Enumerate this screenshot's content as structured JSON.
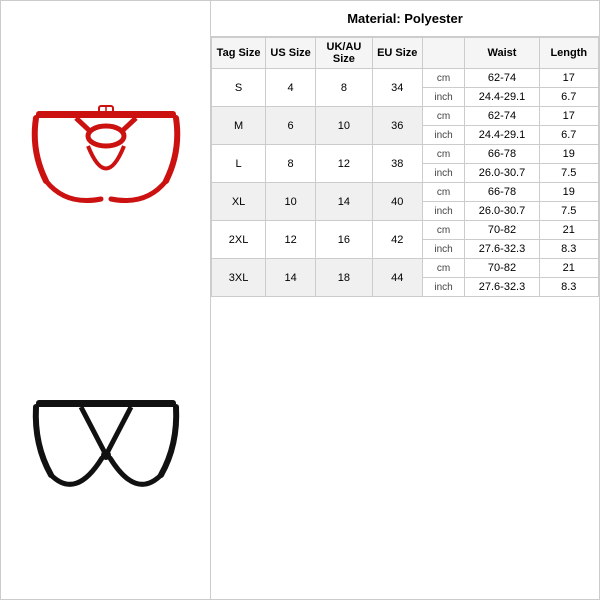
{
  "header": {
    "material_label": "Material: Polyester"
  },
  "columns": {
    "tag_size": "Tag Size",
    "us_size": "US Size",
    "ukau_size": "UK/AU Size",
    "eu_size": "EU Size",
    "waist": "Waist",
    "length": "Length"
  },
  "rows": [
    {
      "tag": "S",
      "us": "4",
      "ukau": "8",
      "eu": "34",
      "cm_waist": "62-74",
      "cm_length": "17",
      "in_waist": "24.4-29.1",
      "in_length": "6.7"
    },
    {
      "tag": "M",
      "us": "6",
      "ukau": "10",
      "eu": "36",
      "cm_waist": "62-74",
      "cm_length": "17",
      "in_waist": "24.4-29.1",
      "in_length": "6.7"
    },
    {
      "tag": "L",
      "us": "8",
      "ukau": "12",
      "eu": "38",
      "cm_waist": "66-78",
      "cm_length": "19",
      "in_waist": "26.0-30.7",
      "in_length": "7.5"
    },
    {
      "tag": "XL",
      "us": "10",
      "ukau": "14",
      "eu": "40",
      "cm_waist": "66-78",
      "cm_length": "19",
      "in_waist": "26.0-30.7",
      "in_length": "7.5"
    },
    {
      "tag": "2XL",
      "us": "12",
      "ukau": "16",
      "eu": "42",
      "cm_waist": "70-82",
      "cm_length": "21",
      "in_waist": "27.6-32.3",
      "in_length": "8.3"
    },
    {
      "tag": "3XL",
      "us": "14",
      "ukau": "18",
      "eu": "44",
      "cm_waist": "70-82",
      "cm_length": "21",
      "in_waist": "27.6-32.3",
      "in_length": "8.3"
    }
  ],
  "units": {
    "cm": "cm",
    "inch": "inch"
  }
}
